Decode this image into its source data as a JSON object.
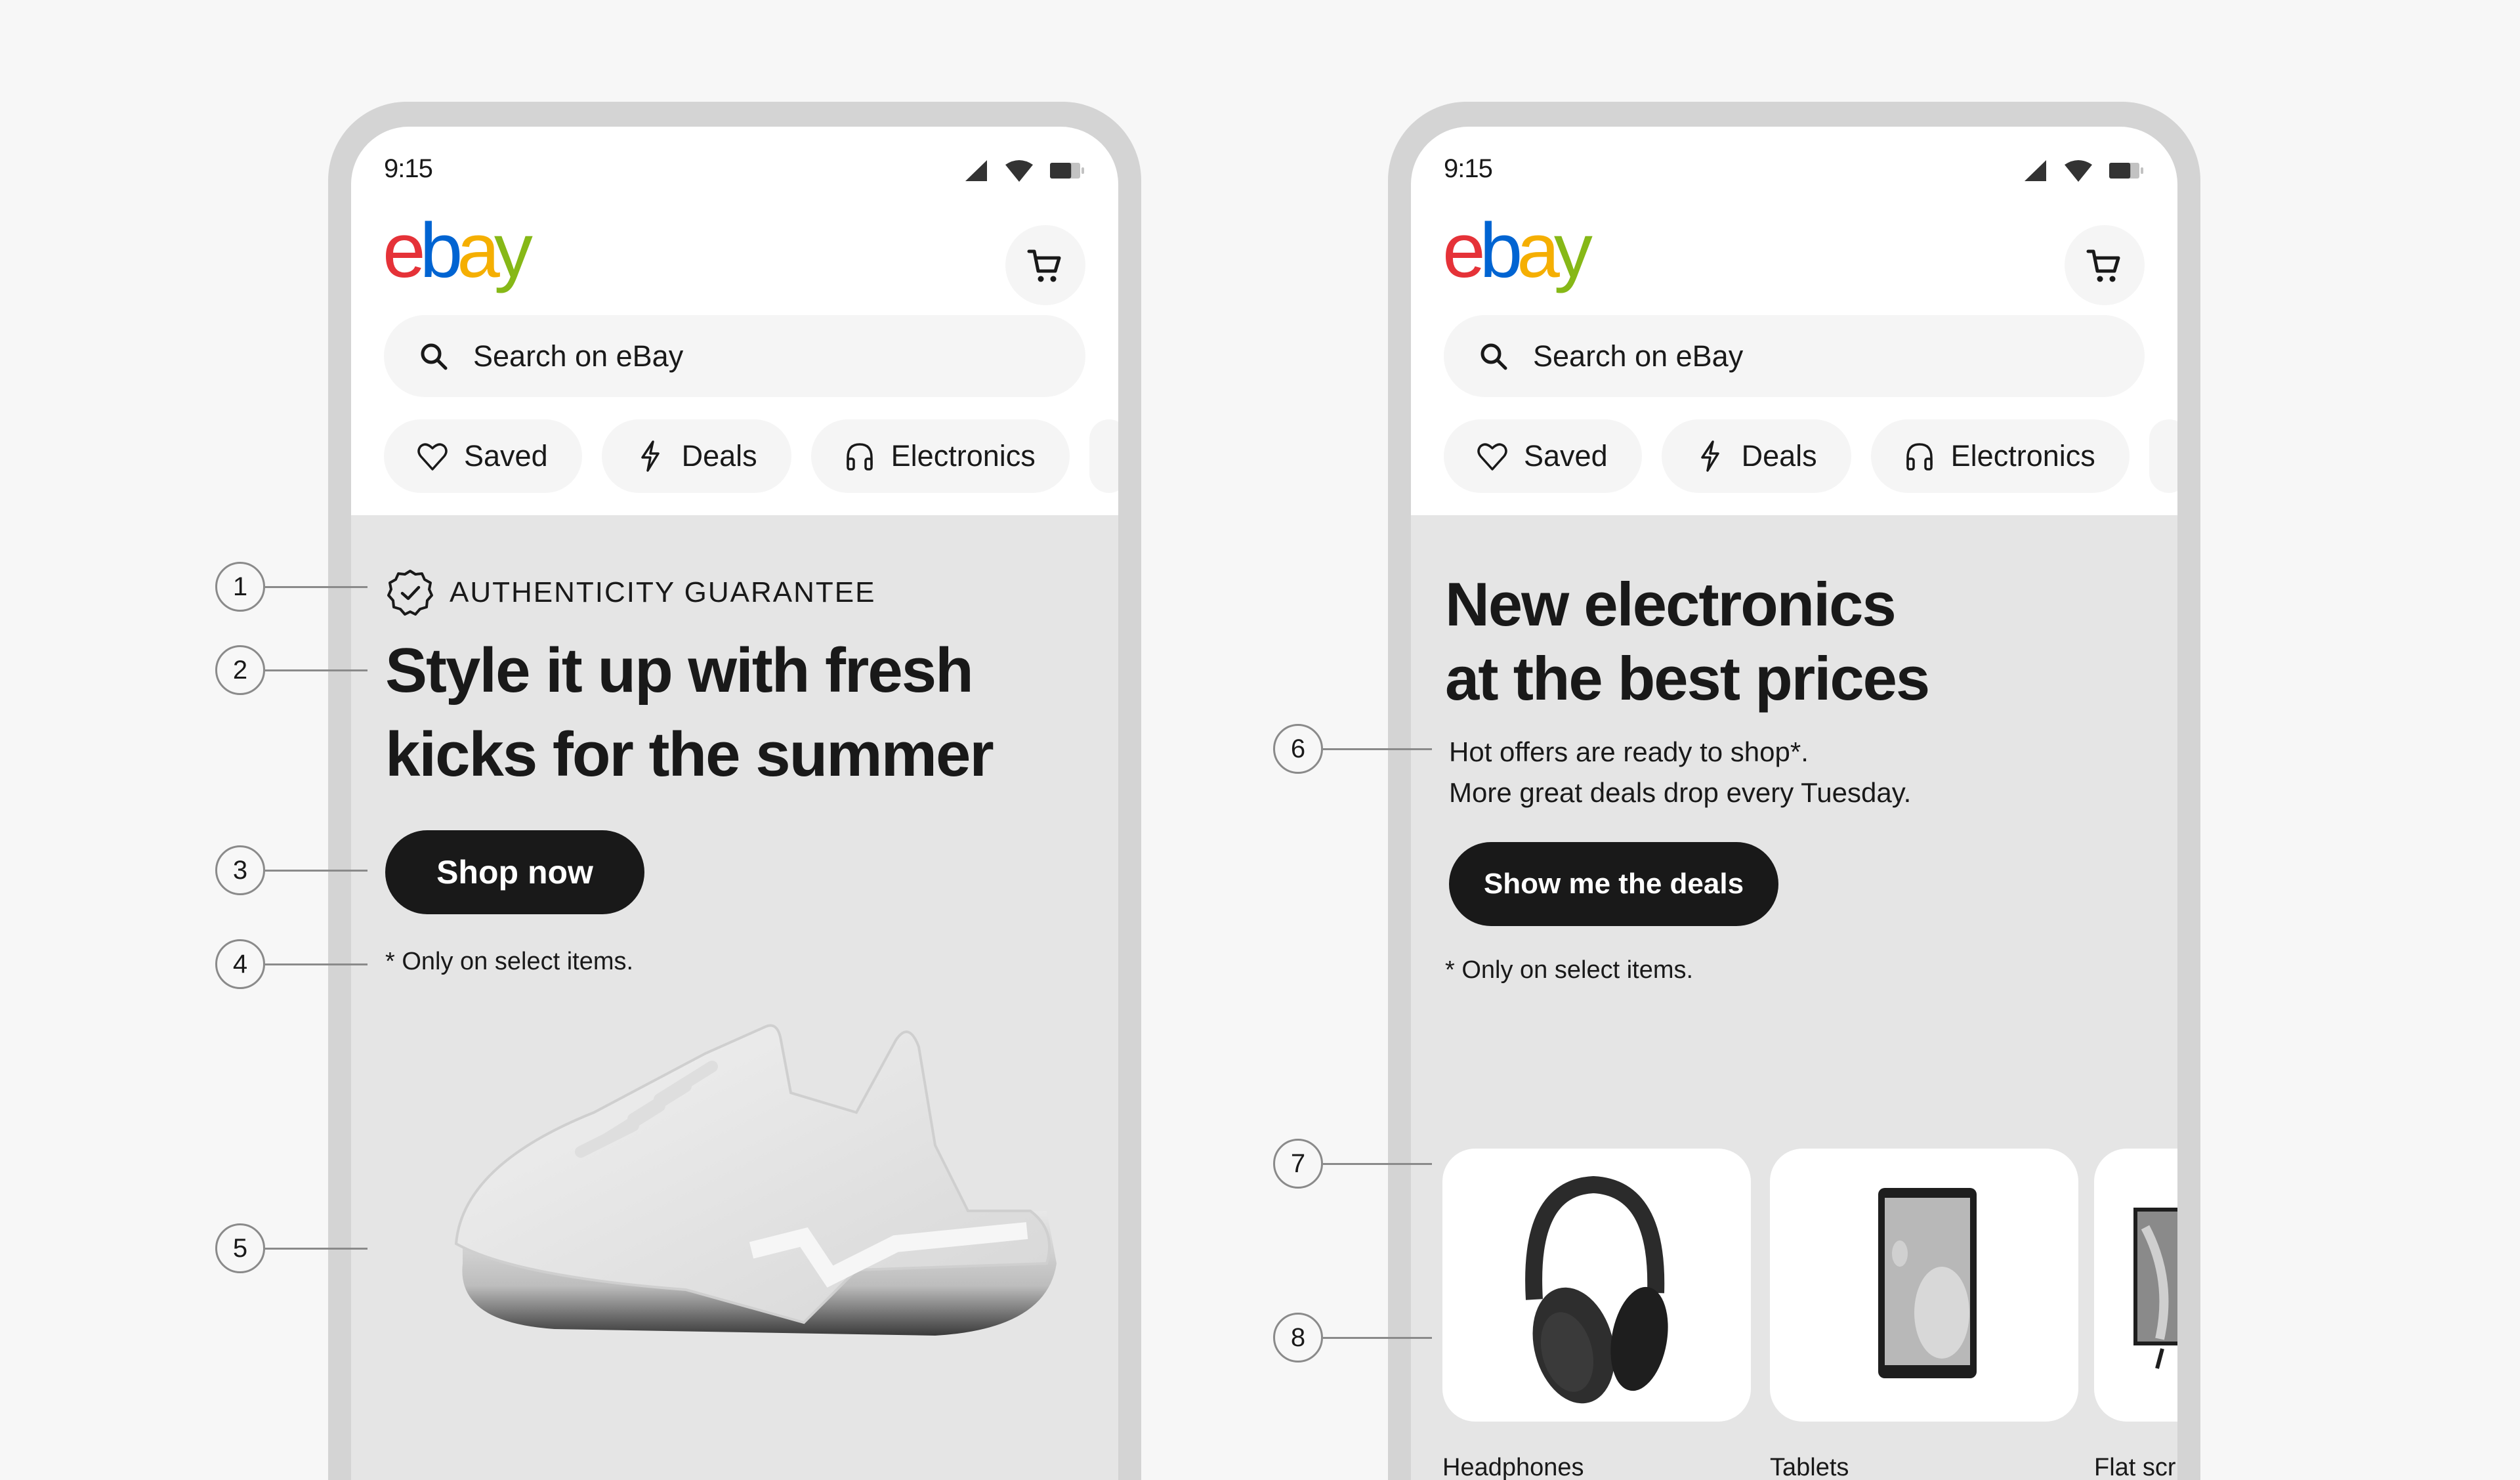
{
  "status_bar": {
    "time": "9:15",
    "battery_level": 0.7,
    "icons": [
      "cellular-signal-icon",
      "wifi-icon",
      "battery-icon"
    ]
  },
  "brand": {
    "logo_letters": [
      "e",
      "b",
      "a",
      "y"
    ],
    "logo_colors": [
      "#e53238",
      "#0064d2",
      "#f5af02",
      "#86b817"
    ]
  },
  "header": {
    "cart_icon": "cart-icon",
    "search_placeholder": "Search on eBay",
    "search_icon": "search-icon"
  },
  "chips": [
    {
      "label": "Saved",
      "icon": "heart-icon"
    },
    {
      "label": "Deals",
      "icon": "lightning-icon"
    },
    {
      "label": "Electronics",
      "icon": "headphones-icon"
    }
  ],
  "left_phone": {
    "eyebrow": "AUTHENTICITY GUARANTEE",
    "eyebrow_icon": "verified-badge-icon",
    "heading_line1": "Style it up with fresh",
    "heading_line2": "kicks for the summer",
    "cta_label": "Shop now",
    "footnote": "* Only on select items.",
    "hero_image": "white-sneaker-image"
  },
  "right_phone": {
    "heading_line1": "New electronics",
    "heading_line2": "at the best prices",
    "subtext_line1": "Hot offers are ready to shop*.",
    "subtext_line2": "More great deals drop every Tuesday.",
    "cta_label": "Show me the deals",
    "footnote": "* Only on select items.",
    "tiles": [
      {
        "label": "Headphones",
        "image": "headphones-image"
      },
      {
        "label": "Tablets",
        "image": "tablet-image"
      },
      {
        "label": "Flat scr",
        "image": "flat-screen-tv-image"
      }
    ]
  },
  "callouts": [
    "1",
    "2",
    "3",
    "4",
    "5",
    "6",
    "7",
    "8"
  ],
  "colors": {
    "background": "#f7f7f7",
    "frame": "#d4d4d4",
    "hero_bg": "#e5e5e5",
    "button": "#191919",
    "chip_bg": "#f5f5f5"
  }
}
